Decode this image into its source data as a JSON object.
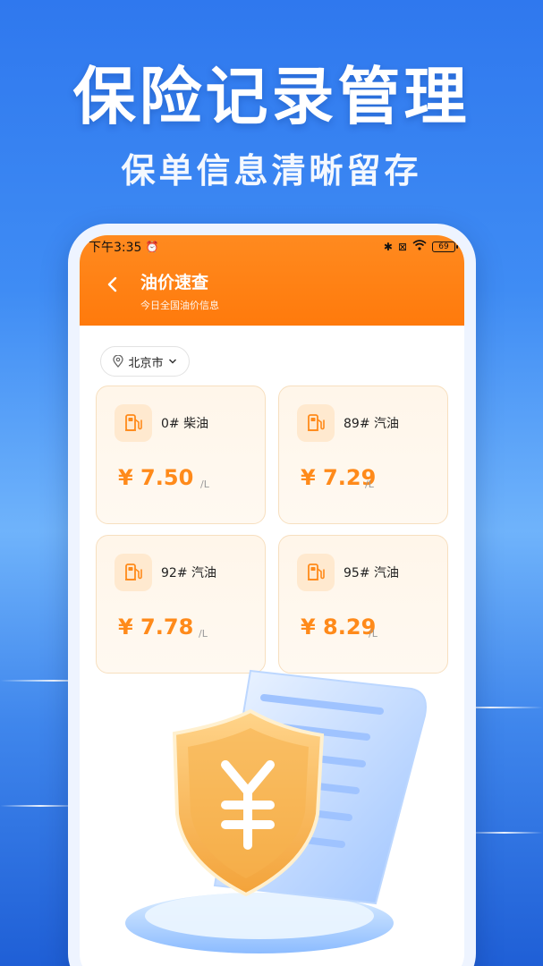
{
  "promo": {
    "title": "保险记录管理",
    "subtitle": "保单信息清晰留存"
  },
  "status_bar": {
    "time": "下午3:35",
    "battery": "69"
  },
  "app_bar": {
    "title": "油价速查",
    "subtitle": "今日全国油价信息"
  },
  "location": {
    "city": "北京市"
  },
  "fuels": [
    {
      "name": "0# 柴油",
      "price": "¥ 7.50",
      "unit": "/L"
    },
    {
      "name": "89# 汽油",
      "price": "¥ 7.29",
      "unit": "/L"
    },
    {
      "name": "92# 汽油",
      "price": "¥ 7.78",
      "unit": "/L"
    },
    {
      "name": "95# 汽油",
      "price": "¥ 8.29",
      "unit": "/L"
    }
  ],
  "colors": {
    "accent": "#ff7a0c",
    "price": "#ff8a1a",
    "background": "#3f8cf4"
  },
  "icons": [
    "back-icon",
    "location-pin-icon",
    "chevron-down-icon",
    "fuel-pump-icon",
    "shield-yuan-icon",
    "receipt-icon"
  ]
}
